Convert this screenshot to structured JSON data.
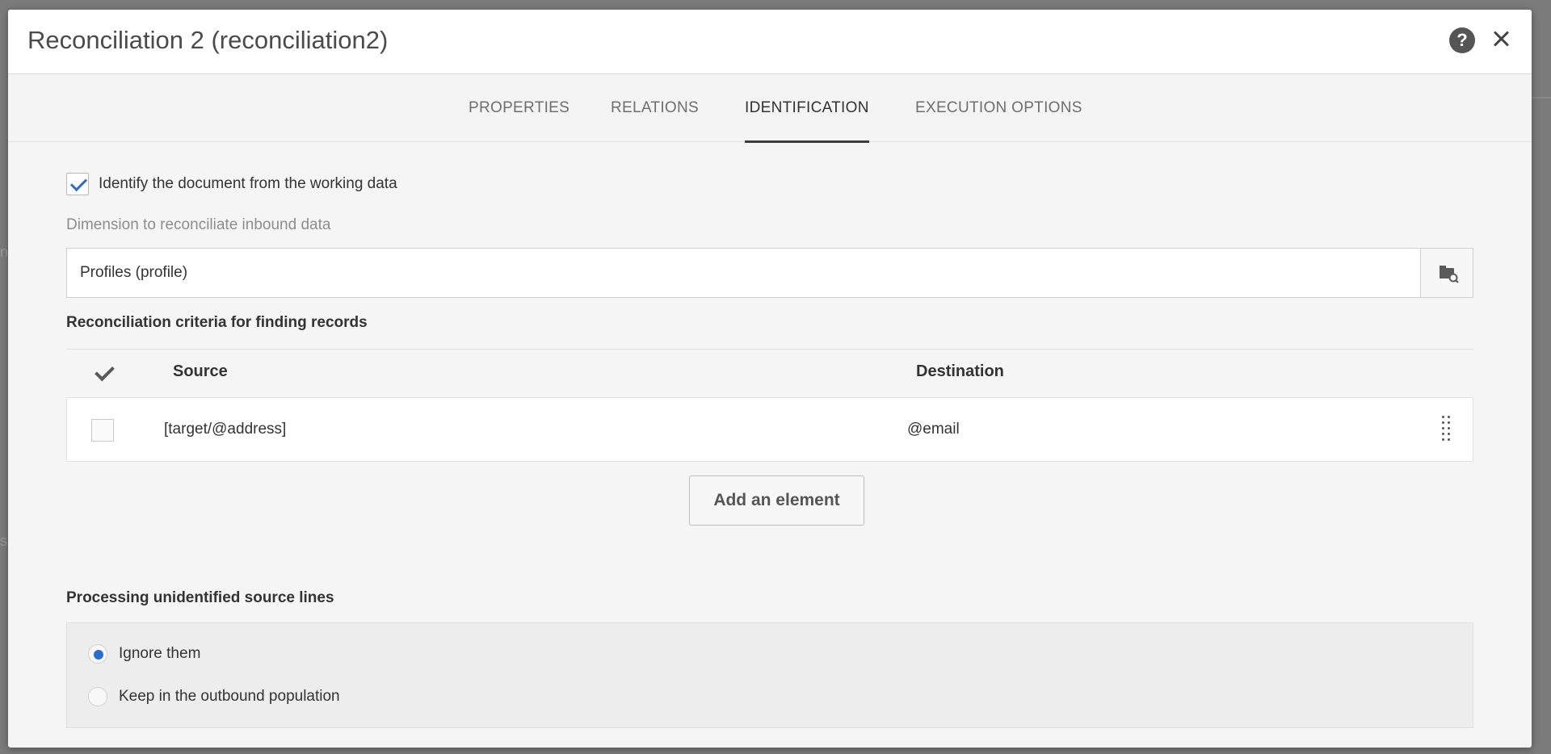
{
  "backdrop": {
    "text_a": "n",
    "text_b": "s"
  },
  "dialog": {
    "title": "Reconciliation 2 (reconciliation2)",
    "help_label": "?",
    "close_label": ""
  },
  "tabs": [
    {
      "label": "PROPERTIES",
      "active": false
    },
    {
      "label": "RELATIONS",
      "active": false
    },
    {
      "label": "IDENTIFICATION",
      "active": true
    },
    {
      "label": "EXECUTION OPTIONS",
      "active": false
    }
  ],
  "identify": {
    "label": "Identify the document from the working data",
    "checked": true
  },
  "dimension": {
    "label": "Dimension to reconciliate inbound data",
    "value": "Profiles (profile)"
  },
  "criteria": {
    "title": "Reconciliation criteria for finding records",
    "headers": {
      "source": "Source",
      "destination": "Destination"
    },
    "rows": [
      {
        "source": "[target/@address]",
        "destination": "@email",
        "checked": false
      }
    ],
    "add_label": "Add an element"
  },
  "unidentified": {
    "title": "Processing unidentified source lines",
    "options": [
      {
        "label": "Ignore them",
        "selected": true
      },
      {
        "label": "Keep in the outbound population",
        "selected": false
      }
    ]
  },
  "colors": {
    "accent": "#2d6ccf",
    "text": "#333333",
    "muted": "#8d8d8d"
  }
}
